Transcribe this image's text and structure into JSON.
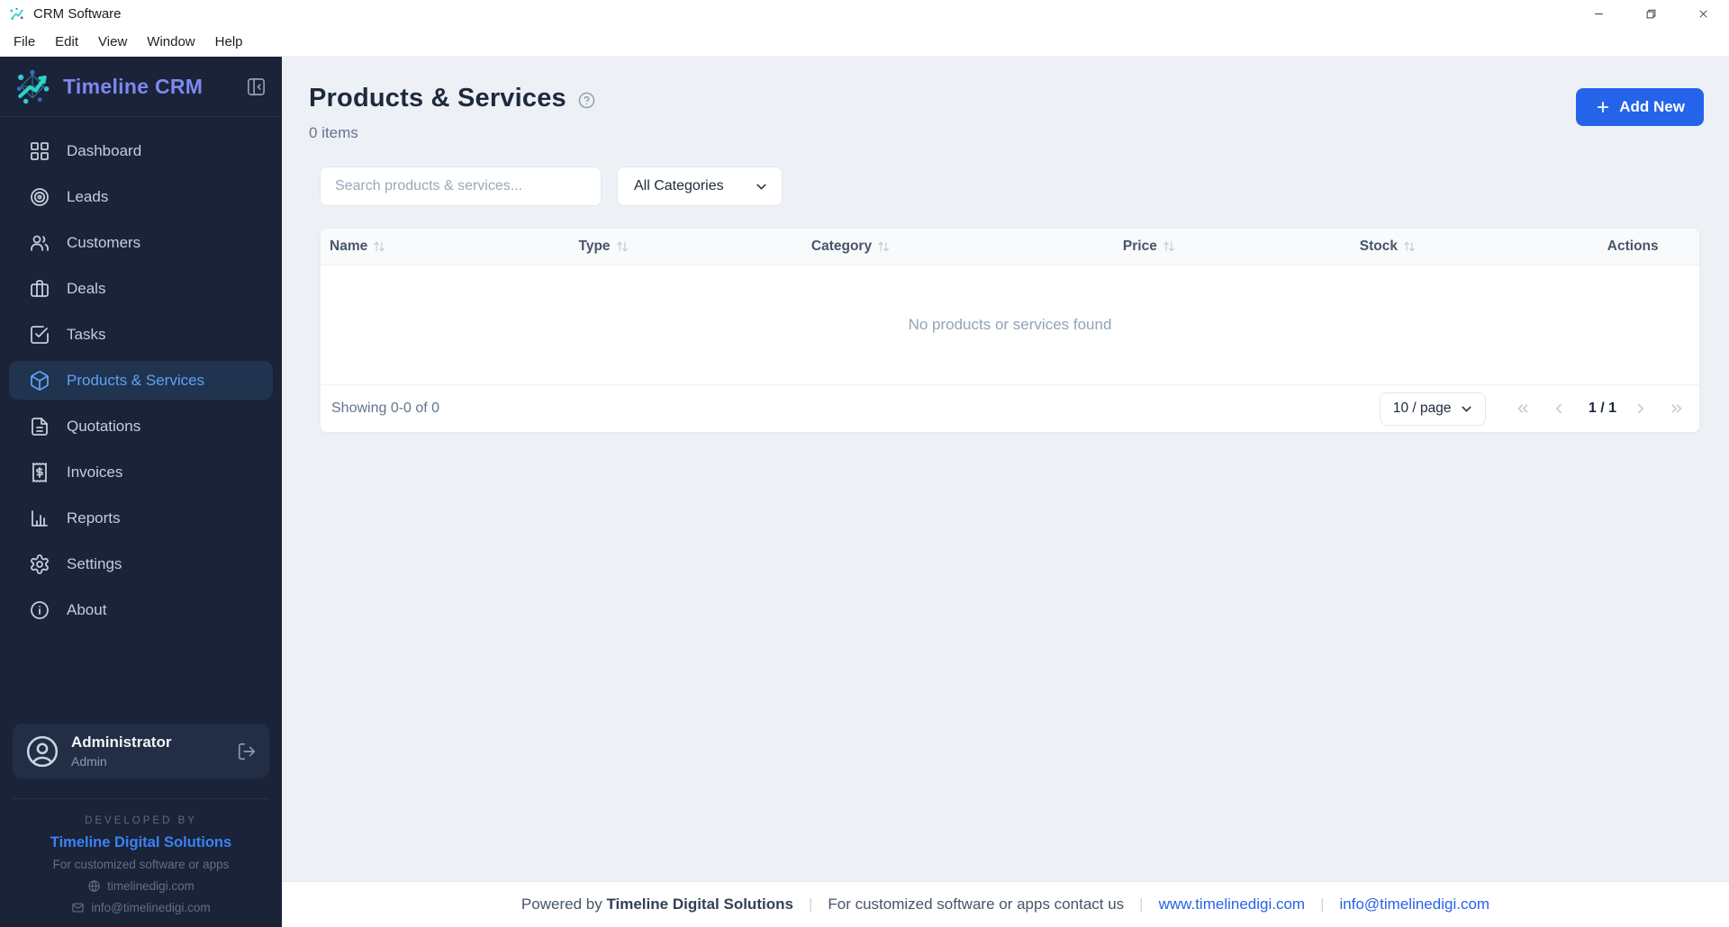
{
  "window": {
    "title": "CRM Software",
    "menu": [
      "File",
      "Edit",
      "View",
      "Window",
      "Help"
    ]
  },
  "sidebar": {
    "brand": "Timeline CRM",
    "items": [
      {
        "label": "Dashboard"
      },
      {
        "label": "Leads"
      },
      {
        "label": "Customers"
      },
      {
        "label": "Deals"
      },
      {
        "label": "Tasks"
      },
      {
        "label": "Products & Services"
      },
      {
        "label": "Quotations"
      },
      {
        "label": "Invoices"
      },
      {
        "label": "Reports"
      },
      {
        "label": "Settings"
      },
      {
        "label": "About"
      }
    ],
    "active_item": "Products & Services",
    "user": {
      "name": "Administrator",
      "role": "Admin"
    },
    "developed_by": {
      "heading": "DEVELOPED BY",
      "company": "Timeline Digital Solutions",
      "tagline": "For customized software or apps",
      "website": "timelinedigi.com",
      "email": "info@timelinedigi.com"
    }
  },
  "main": {
    "page_title": "Products & Services",
    "items_count": "0 items",
    "add_new_label": "Add New",
    "search_placeholder": "Search products & services...",
    "category_filter_value": "All Categories",
    "table": {
      "columns": [
        "Name",
        "Type",
        "Category",
        "Price",
        "Stock",
        "Actions"
      ],
      "empty_message": "No products or services found"
    },
    "pagination": {
      "showing": "Showing 0-0 of 0",
      "page_size_value": "10 / page",
      "page_indicator": "1 / 1"
    }
  },
  "footer": {
    "powered_by": "Powered by",
    "company": "Timeline Digital Solutions",
    "contact_text": "For customized software or apps contact us",
    "website": "www.timelinedigi.com",
    "email": "info@timelinedigi.com",
    "separator": "|"
  },
  "colors": {
    "accent": "#2563eb",
    "sidebar_bg": "#1a2337",
    "active_text": "#5ea1f7",
    "brand_text": "#7e88f2",
    "link": "#2563eb"
  }
}
